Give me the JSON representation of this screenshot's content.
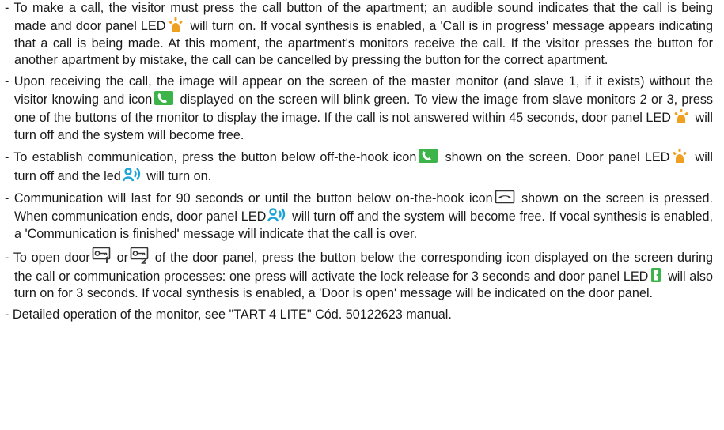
{
  "paragraphs": [
    {
      "segments": [
        "- To make a call, the visitor must press the call button of the apartment; an audible sound indicates that the call is being made and door panel LED",
        " will turn on. If vocal synthesis is enabled, a 'Call is in progress' message appears indicating that a call is being made. At this moment, the apartment's monitors receive the call. If the visitor presses the button for another apartment by mistake, the call can be cancelled by pressing the button for the correct apartment."
      ],
      "icons": [
        "call-led-icon"
      ]
    },
    {
      "segments": [
        "- Upon receiving the call, the image will appear on the screen of the master monitor (and slave 1, if it exists) without the visitor knowing and icon",
        " displayed on the screen will blink green. To view the image from slave monitors 2 or 3, press one of the buttons of the monitor to display the image. If the call is not answered within 45 seconds, door panel LED",
        " will turn off and the system will become free."
      ],
      "icons": [
        "off-hook-icon",
        "call-led-icon"
      ]
    },
    {
      "segments": [
        "- To establish communication, press the button below off-the-hook icon",
        " shown on the screen. Door panel LED",
        " will turn off and the led",
        " will turn on."
      ],
      "icons": [
        "off-hook-icon",
        "call-led-icon",
        "communication-led-icon"
      ]
    },
    {
      "segments": [
        "- Communication will last for 90 seconds or until the button below on-the-hook icon",
        " shown on the screen is pressed. When communication ends, door panel LED",
        " will turn off and the system will become free. If vocal synthesis is enabled, a 'Communication is finished' message will indicate that the call is over."
      ],
      "icons": [
        "on-hook-icon",
        "communication-led-icon"
      ]
    },
    {
      "segments": [
        "- To open door",
        " or",
        " of the door panel, press the button below the corresponding icon displayed on the screen during the call or communication processes: one press will activate the lock release for 3 seconds and door panel LED",
        " will also turn on for 3 seconds. If vocal synthesis is enabled, a 'Door is open' message will be indicated on the door panel."
      ],
      "icons": [
        "door-1-key-icon",
        "door-2-key-icon",
        "door-led-icon"
      ]
    },
    {
      "segments": [
        "- Detailed operation of the monitor, see \"TART 4 LITE\" Cód. 50122623 manual."
      ],
      "icons": []
    }
  ],
  "colors": {
    "call_led": "#f0a020",
    "off_hook_bg": "#3cb44a",
    "communication_led": "#1aa3d6",
    "door_led": "#3cb44a",
    "on_hook": "#333333"
  }
}
